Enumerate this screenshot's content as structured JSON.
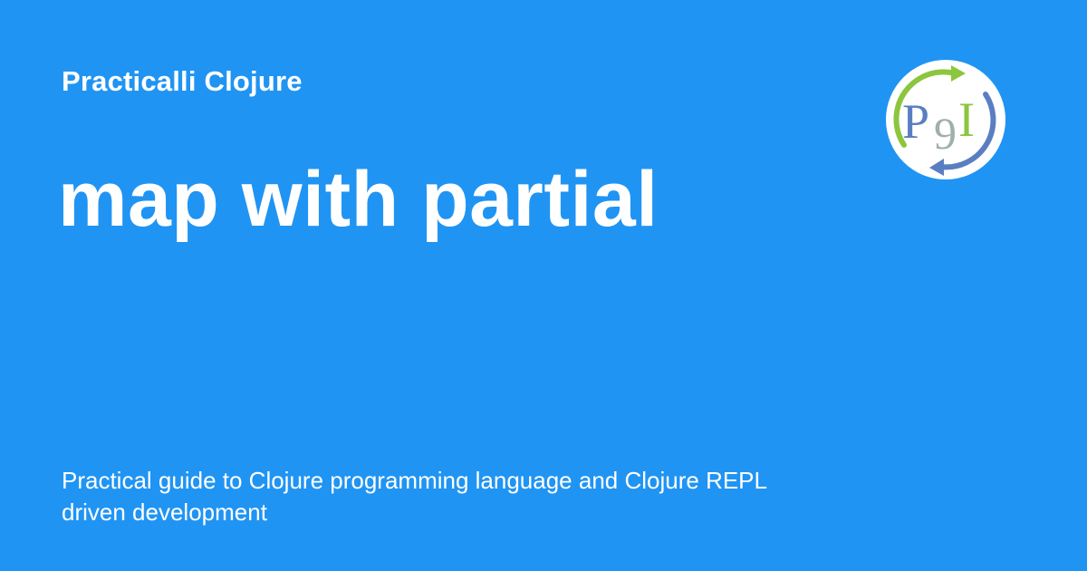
{
  "site": {
    "name": "Practicalli Clojure"
  },
  "page": {
    "title": "map with partial",
    "description": "Practical guide to Clojure programming language and Clojure REPL driven development"
  },
  "logo": {
    "letter_left": "P",
    "letter_middle": "9",
    "letter_right": "I"
  },
  "colors": {
    "background": "#2094f3",
    "text": "#ffffff",
    "logo_green": "#8cc63f",
    "logo_blue": "#5a7ec2",
    "logo_grey": "#9fb0a8"
  }
}
